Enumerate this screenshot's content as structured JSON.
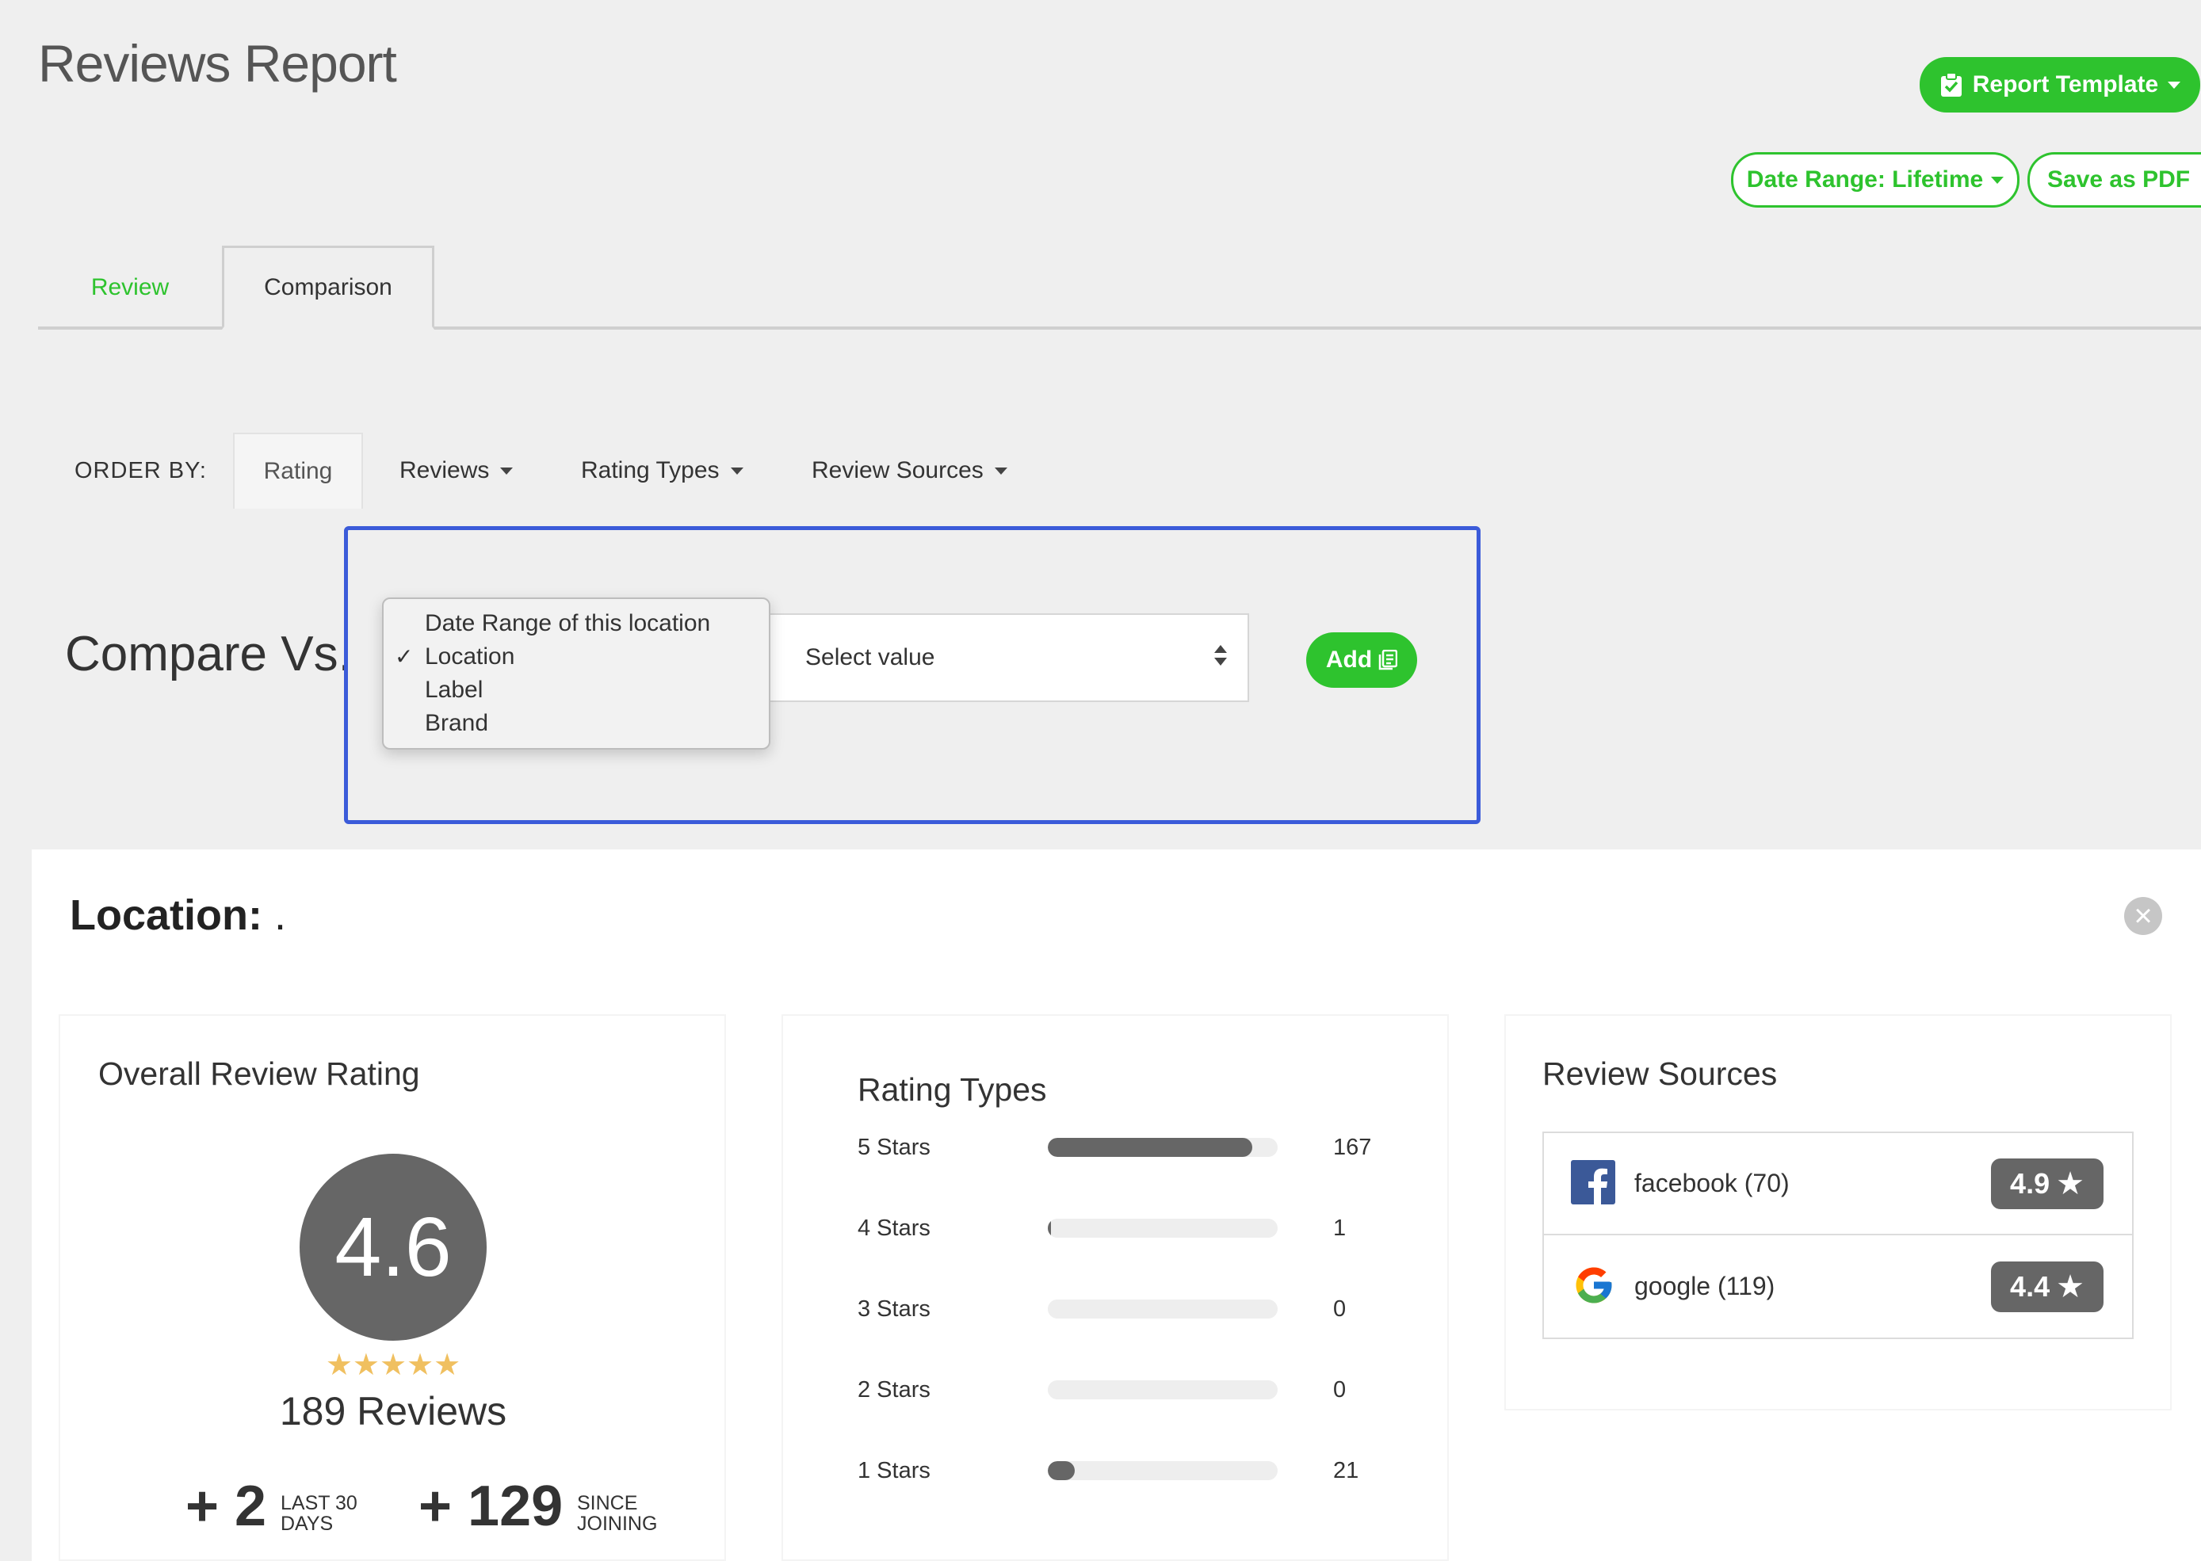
{
  "header": {
    "title": "Reviews Report",
    "report_template_label": "Report Template",
    "date_range_label": "Date Range: Lifetime",
    "save_pdf_label": "Save as PDF"
  },
  "tabs": [
    {
      "label": "Review",
      "active": false
    },
    {
      "label": "Comparison",
      "active": true
    }
  ],
  "order_by": {
    "label": "ORDER BY:",
    "items": [
      "Rating",
      "Reviews",
      "Rating Types",
      "Review Sources"
    ]
  },
  "compare": {
    "label": "Compare Vs.",
    "dropdown_options": [
      {
        "label": "Date Range of this location",
        "checked": false
      },
      {
        "label": "Location",
        "checked": true
      },
      {
        "label": "Label",
        "checked": false
      },
      {
        "label": "Brand",
        "checked": false
      }
    ],
    "check_mark": "✓",
    "select_placeholder": "Select value",
    "add_label": "Add"
  },
  "location": {
    "title": "Location:",
    "value": ".",
    "close_symbol": "×"
  },
  "overall": {
    "title": "Overall Review Rating",
    "rating": "4.6",
    "stars": "★★★★★",
    "reviews_label": "189 Reviews",
    "stat1_value": "+ 2",
    "stat1_line1": "LAST 30",
    "stat1_line2": "DAYS",
    "stat2_value": "+ 129",
    "stat2_line1": "SINCE",
    "stat2_line2": "JOINING"
  },
  "rating_types": {
    "title": "Rating Types",
    "rows": [
      {
        "label": "5 Stars",
        "count": "167",
        "fraction": 0.89
      },
      {
        "label": "4 Stars",
        "count": "1",
        "fraction": 0.006
      },
      {
        "label": "3 Stars",
        "count": "0",
        "fraction": 0
      },
      {
        "label": "2 Stars",
        "count": "0",
        "fraction": 0
      },
      {
        "label": "1 Stars",
        "count": "21",
        "fraction": 0.111
      }
    ]
  },
  "review_sources": {
    "title": "Review Sources",
    "sources": [
      {
        "name": "facebook (70)",
        "rating": "4.9",
        "icon": "facebook-icon"
      },
      {
        "name": "google (119)",
        "rating": "4.4",
        "icon": "google-icon"
      }
    ]
  },
  "colors": {
    "accent_green": "#2ec32e",
    "highlight_blue": "#3b5bd9",
    "star_gold": "#f0c060",
    "badge_gray": "#666666"
  }
}
